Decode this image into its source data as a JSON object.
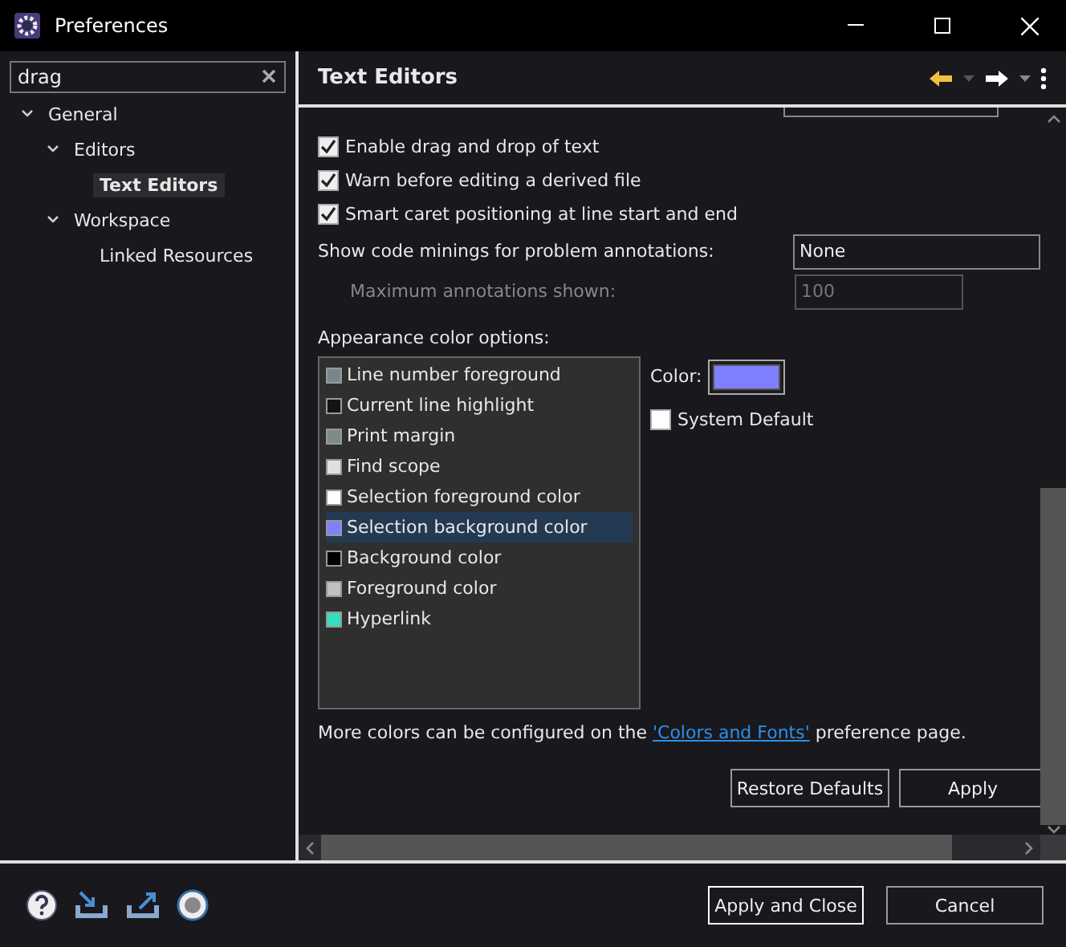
{
  "window": {
    "title": "Preferences"
  },
  "filter": {
    "value": "drag"
  },
  "tree": [
    {
      "label": "General",
      "expanded": true,
      "selected": false,
      "children": [
        {
          "label": "Editors",
          "expanded": true,
          "selected": false,
          "children": [
            {
              "label": "Text Editors",
              "selected": true
            }
          ]
        },
        {
          "label": "Workspace",
          "expanded": true,
          "selected": false,
          "children": [
            {
              "label": "Linked Resources",
              "selected": false
            }
          ]
        }
      ]
    }
  ],
  "page": {
    "title": "Text Editors"
  },
  "options": [
    {
      "label": "Enable drag and drop of text",
      "checked": true
    },
    {
      "label": "Warn before editing a derived file",
      "checked": true
    },
    {
      "label": "Smart caret positioning at line start and end",
      "checked": true
    }
  ],
  "code_minings": {
    "label": "Show code minings for problem annotations:",
    "value": "None"
  },
  "max_annotations": {
    "label": "Maximum annotations shown:",
    "value": "100",
    "disabled": true
  },
  "appearance": {
    "label": "Appearance color options:",
    "items": [
      {
        "label": "Line number foreground",
        "color": "#78878b",
        "selected": false
      },
      {
        "label": "Current line highlight",
        "color": "#141414",
        "selected": false
      },
      {
        "label": "Print margin",
        "color": "#7e8b8b",
        "selected": false
      },
      {
        "label": "Find scope",
        "color": "#e0e0e0",
        "selected": false
      },
      {
        "label": "Selection foreground color",
        "color": "#ffffff",
        "selected": false
      },
      {
        "label": "Selection background color",
        "color": "#8080ff",
        "selected": true
      },
      {
        "label": "Background color",
        "color": "#000000",
        "selected": false
      },
      {
        "label": "Foreground color",
        "color": "#c0c0c0",
        "selected": false
      },
      {
        "label": "Hyperlink",
        "color": "#30e0c0",
        "selected": false
      }
    ],
    "color_label": "Color:",
    "system_default": {
      "label": "System Default",
      "checked": false
    }
  },
  "more_colors": {
    "before": "More colors can be configured on the ",
    "link": "'Colors and Fonts'",
    "after": " preference page."
  },
  "page_buttons": [
    "Restore Defaults",
    "Apply"
  ],
  "dialog_buttons": [
    "Apply and Close",
    "Cancel"
  ]
}
